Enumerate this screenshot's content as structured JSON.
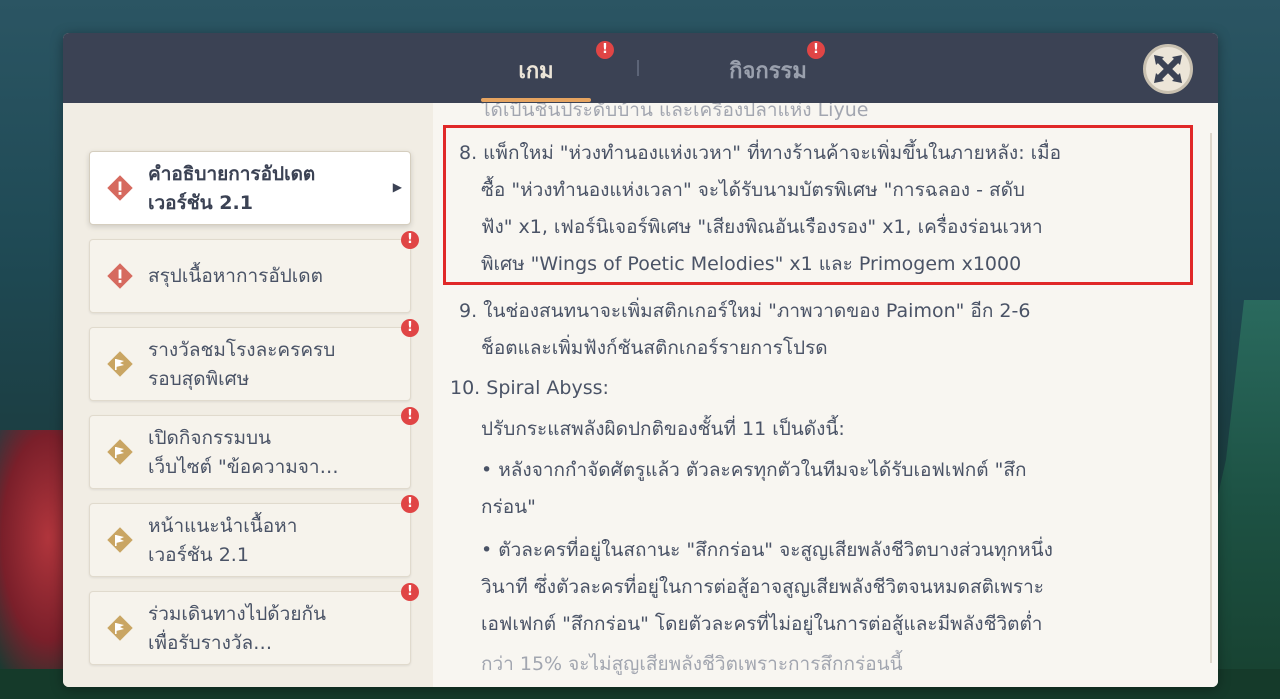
{
  "tabs": [
    {
      "label": "เกม",
      "active": true,
      "alert": "!"
    },
    {
      "label": "กิจกรรม",
      "active": false,
      "alert": "!"
    }
  ],
  "colors": {
    "header": "#3b4254",
    "panel": "#f1ede4",
    "accent": "#e6a460",
    "alert": "#e04545",
    "highlight": "#e02828",
    "icon_notice": "#d66a5f",
    "icon_event": "#c9a563"
  },
  "sidebar": {
    "items": [
      {
        "label_lines": [
          "คำอธิบายการอัปเดต",
          "เวอร์ชัน 2.1"
        ],
        "icon": "exclamation-diamond-icon",
        "active": true,
        "alert": null
      },
      {
        "label_lines": [
          "สรุปเนื้อหาการอัปเดต",
          ""
        ],
        "icon": "exclamation-diamond-icon",
        "active": false,
        "alert": "!"
      },
      {
        "label_lines": [
          "รางวัลชมโรงละครครบ",
          "รอบสุดพิเศษ"
        ],
        "icon": "flag-diamond-icon",
        "active": false,
        "alert": "!"
      },
      {
        "label_lines": [
          "เปิดกิจกรรมบน",
          "เว็บไซต์ \"ข้อความจา…"
        ],
        "icon": "flag-diamond-icon",
        "active": false,
        "alert": "!"
      },
      {
        "label_lines": [
          "หน้าแนะนำเนื้อหา",
          "เวอร์ชัน 2.1"
        ],
        "icon": "flag-diamond-icon",
        "active": false,
        "alert": "!"
      },
      {
        "label_lines": [
          "ร่วมเดินทางไปด้วยกัน",
          "เพื่อรับรางวัล…"
        ],
        "icon": "flag-diamond-icon",
        "active": false,
        "alert": "!"
      }
    ]
  },
  "content": {
    "lines": [
      {
        "text": "ได้เป็นชิ้นประดับบ้าน และเครื่องปลาแห่ง Liyue",
        "indent": 0,
        "faded": true
      },
      {
        "text": "8. แพ็กใหม่ \"ห่วงทำนองแห่งเวหา\" ที่ทางร้านค้าจะเพิ่มขึ้นในภายหลัง: เมื่อ",
        "indent": 0,
        "faded": false
      },
      {
        "text": "ซื้อ \"ห่วงทำนองแห่งเวลา\" จะได้รับนามบัตรพิเศษ \"การฉลอง - สดับ",
        "indent": 1,
        "faded": false
      },
      {
        "text": "ฟัง\" x1, เฟอร์นิเจอร์พิเศษ \"เสียงพิณอันเรืองรอง\" x1, เครื่องร่อนเวหา",
        "indent": 1,
        "faded": false
      },
      {
        "text": "พิเศษ \"Wings of Poetic Melodies\" x1 และ Primogem x1000",
        "indent": 1,
        "faded": false
      },
      {
        "text": "9. ในช่องสนทนาจะเพิ่มสติกเกอร์ใหม่ \"ภาพวาดของ Paimon\" อีก 2-6",
        "indent": 0,
        "faded": false
      },
      {
        "text": "ช็อตและเพิ่มฟังก์ชันสติกเกอร์รายการโปรด",
        "indent": 1,
        "faded": false
      },
      {
        "text": "10. Spiral Abyss:",
        "indent": -1,
        "faded": false
      },
      {
        "text": "ปรับกระแสพลังผิดปกติของชั้นที่ 11 เป็นดังนี้:",
        "indent": 1,
        "faded": false
      },
      {
        "text": "• หลังจากกำจัดศัตรูแล้ว ตัวละครทุกตัวในทีมจะได้รับเอฟเฟกต์ \"สึก",
        "indent": 1,
        "faded": false
      },
      {
        "text": "กร่อน\"",
        "indent": 1,
        "faded": false
      },
      {
        "text": "• ตัวละครที่อยู่ในสถานะ \"สึกกร่อน\" จะสูญเสียพลังชีวิตบางส่วนทุกหนึ่ง",
        "indent": 1,
        "faded": false
      },
      {
        "text": "วินาที ซึ่งตัวละครที่อยู่ในการต่อสู้อาจสูญเสียพลังชีวิตจนหมดสติเพราะ",
        "indent": 1,
        "faded": false
      },
      {
        "text": "เอฟเฟกต์ \"สึกกร่อน\" โดยตัวละครที่ไม่อยู่ในการต่อสู้และมีพลังชีวิตต่ำ",
        "indent": 1,
        "faded": false
      },
      {
        "text": "กว่า 15% จะไม่สูญเสียพลังชีวิตเพราะการสึกกร่อนนี้",
        "indent": 1,
        "faded": true
      }
    ]
  }
}
